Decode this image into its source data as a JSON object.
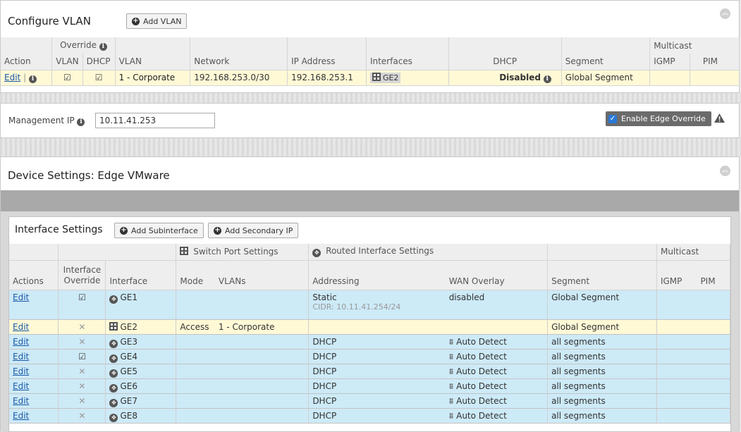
{
  "configure_vlan": {
    "title": "Configure VLAN",
    "add_vlan_label": "Add VLAN",
    "group_headers": {
      "override": "Override",
      "multicast": "Multicast"
    },
    "columns": {
      "action": "Action",
      "vlan_override": "VLAN",
      "dhcp_override": "DHCP",
      "vlan": "VLAN",
      "network": "Network",
      "ip_address": "IP Address",
      "interfaces": "Interfaces",
      "dhcp": "DHCP",
      "segment": "Segment",
      "igmp": "IGMP",
      "pim": "PIM"
    },
    "row": {
      "edit_label": "Edit",
      "vlan": "1 - Corporate",
      "network": "192.168.253.0/30",
      "ip_address": "192.168.253.1",
      "interface": "GE2",
      "dhcp": "Disabled",
      "segment": "Global Segment"
    }
  },
  "management": {
    "label": "Management IP",
    "value": "10.11.41.253",
    "enable_override_label": "Enable Edge Override",
    "enable_override_checked": true
  },
  "device_settings": {
    "title": "Device Settings: Edge VMware"
  },
  "interface_settings": {
    "title": "Interface Settings",
    "add_subinterface_label": "Add Subinterface",
    "add_secondary_ip_label": "Add Secondary IP",
    "group_headers": {
      "switch_port": "Switch Port Settings",
      "routed": "Routed Interface Settings",
      "multicast": "Multicast"
    },
    "columns": {
      "actions": "Actions",
      "interface_override_line1": "Interface",
      "interface_override_line2": "Override",
      "interface": "Interface",
      "mode": "Mode",
      "vlans": "VLANs",
      "addressing": "Addressing",
      "wan_overlay": "WAN Overlay",
      "segment": "Segment",
      "igmp": "IGMP",
      "pim": "PIM"
    },
    "rows": [
      {
        "edit": "Edit",
        "override": "check",
        "type": "routed",
        "interface": "GE1",
        "mode": "",
        "vlans": "",
        "addressing": "Static",
        "cidr": "CIDR: 10.11.41.254/24",
        "wan_overlay": "disabled",
        "segment": "Global Segment",
        "color": "blue"
      },
      {
        "edit": "Edit",
        "override": "cross",
        "type": "switch",
        "interface": "GE2",
        "mode": "Access",
        "vlans": "1 - Corporate",
        "addressing": "",
        "cidr": "",
        "wan_overlay": "",
        "segment": "Global Segment",
        "color": "yellow"
      },
      {
        "edit": "Edit",
        "override": "cross",
        "type": "routed",
        "interface": "GE3",
        "mode": "",
        "vlans": "",
        "addressing": "DHCP",
        "cidr": "",
        "wan_overlay": "Auto Detect",
        "segment": "all segments",
        "color": "blue"
      },
      {
        "edit": "Edit",
        "override": "check",
        "type": "routed",
        "interface": "GE4",
        "mode": "",
        "vlans": "",
        "addressing": "DHCP",
        "cidr": "",
        "wan_overlay": "Auto Detect",
        "segment": "all segments",
        "color": "blue"
      },
      {
        "edit": "Edit",
        "override": "cross",
        "type": "routed",
        "interface": "GE5",
        "mode": "",
        "vlans": "",
        "addressing": "DHCP",
        "cidr": "",
        "wan_overlay": "Auto Detect",
        "segment": "all segments",
        "color": "blue"
      },
      {
        "edit": "Edit",
        "override": "cross",
        "type": "routed",
        "interface": "GE6",
        "mode": "",
        "vlans": "",
        "addressing": "DHCP",
        "cidr": "",
        "wan_overlay": "Auto Detect",
        "segment": "all segments",
        "color": "blue"
      },
      {
        "edit": "Edit",
        "override": "cross",
        "type": "routed",
        "interface": "GE7",
        "mode": "",
        "vlans": "",
        "addressing": "DHCP",
        "cidr": "",
        "wan_overlay": "Auto Detect",
        "segment": "all segments",
        "color": "blue"
      },
      {
        "edit": "Edit",
        "override": "cross",
        "type": "routed",
        "interface": "GE8",
        "mode": "",
        "vlans": "",
        "addressing": "DHCP",
        "cidr": "",
        "wan_overlay": "Auto Detect",
        "segment": "all segments",
        "color": "blue"
      }
    ]
  },
  "icons": {
    "info": "info-circle-icon",
    "collapse": "double-chevron-up-icon",
    "add": "plus-circle-icon",
    "checkbox": "checked-box-icon",
    "cross": "x-mark-icon",
    "switch_port": "switch-port-icon",
    "routed": "routed-interface-icon",
    "auto_detect": "auto-detect-icon",
    "warning": "warning-triangle-icon"
  }
}
